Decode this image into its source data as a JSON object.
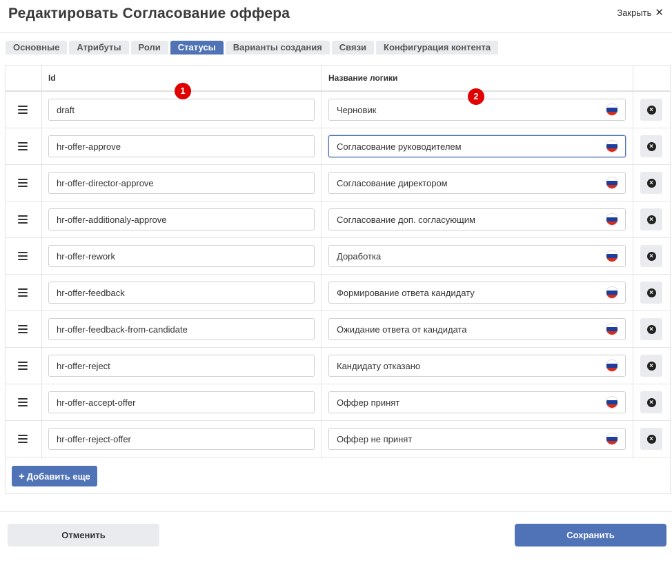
{
  "dialog": {
    "title": "Редактировать Согласование оффера",
    "close_label": "Закрыть"
  },
  "tabs": [
    {
      "label": "Основные",
      "active": false
    },
    {
      "label": "Атрибуты",
      "active": false
    },
    {
      "label": "Роли",
      "active": false
    },
    {
      "label": "Статусы",
      "active": true
    },
    {
      "label": "Варианты создания",
      "active": false
    },
    {
      "label": "Связи",
      "active": false
    },
    {
      "label": "Конфигурация контента",
      "active": false
    }
  ],
  "table": {
    "columns": [
      "Id",
      "Название логики"
    ],
    "rows": [
      {
        "id": "draft",
        "name": "Черновик"
      },
      {
        "id": "hr-offer-approve",
        "name": "Согласование руководителем"
      },
      {
        "id": "hr-offer-director-approve",
        "name": "Согласование директором"
      },
      {
        "id": "hr-offer-additionaly-approve",
        "name": "Согласование доп. согласующим"
      },
      {
        "id": "hr-offer-rework",
        "name": "Доработка"
      },
      {
        "id": "hr-offer-feedback",
        "name": "Формирование ответа кандидату"
      },
      {
        "id": "hr-offer-feedback-from-candidate",
        "name": "Ожидание ответа от кандидата"
      },
      {
        "id": "hr-offer-reject",
        "name": "Кандидату отказано"
      },
      {
        "id": "hr-offer-accept-offer",
        "name": "Оффер принят"
      },
      {
        "id": "hr-offer-reject-offer",
        "name": "Оффер не принят"
      }
    ],
    "language_icon": "russia-flag-icon",
    "row_handle_icon": "drag-handle-icon",
    "delete_icon": "remove-circle-icon"
  },
  "annotations": {
    "marker_1": "1",
    "marker_2": "2"
  },
  "actions": {
    "add_label": "Добавить еще",
    "cancel_label": "Отменить",
    "save_label": "Сохранить"
  },
  "colors": {
    "accent": "#4f73b6",
    "marker": "#e00000",
    "tab_bg": "#e9ebee"
  }
}
